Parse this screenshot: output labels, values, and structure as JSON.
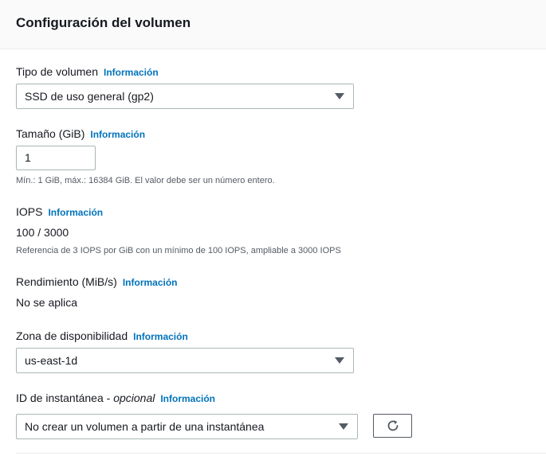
{
  "panel": {
    "title": "Configuración del volumen"
  },
  "info_label": "Información",
  "volume_type": {
    "label": "Tipo de volumen",
    "selected": "SSD de uso general (gp2)"
  },
  "size": {
    "label": "Tamaño (GiB)",
    "value": "1",
    "hint": "Mín.: 1 GiB, máx.: 16384 GiB. El valor debe ser un número entero."
  },
  "iops": {
    "label": "IOPS",
    "value": "100 / 3000",
    "hint": "Referencia de 3 IOPS por GiB con un mínimo de 100 IOPS, ampliable a 3000 IOPS"
  },
  "throughput": {
    "label": "Rendimiento (MiB/s)",
    "value": "No se aplica"
  },
  "availability_zone": {
    "label": "Zona de disponibilidad",
    "selected": "us-east-1d"
  },
  "snapshot": {
    "label": "ID de instantánea - ",
    "optional": "opcional",
    "selected": "No crear un volumen a partir de una instantánea",
    "refresh_icon": "refresh-icon"
  }
}
